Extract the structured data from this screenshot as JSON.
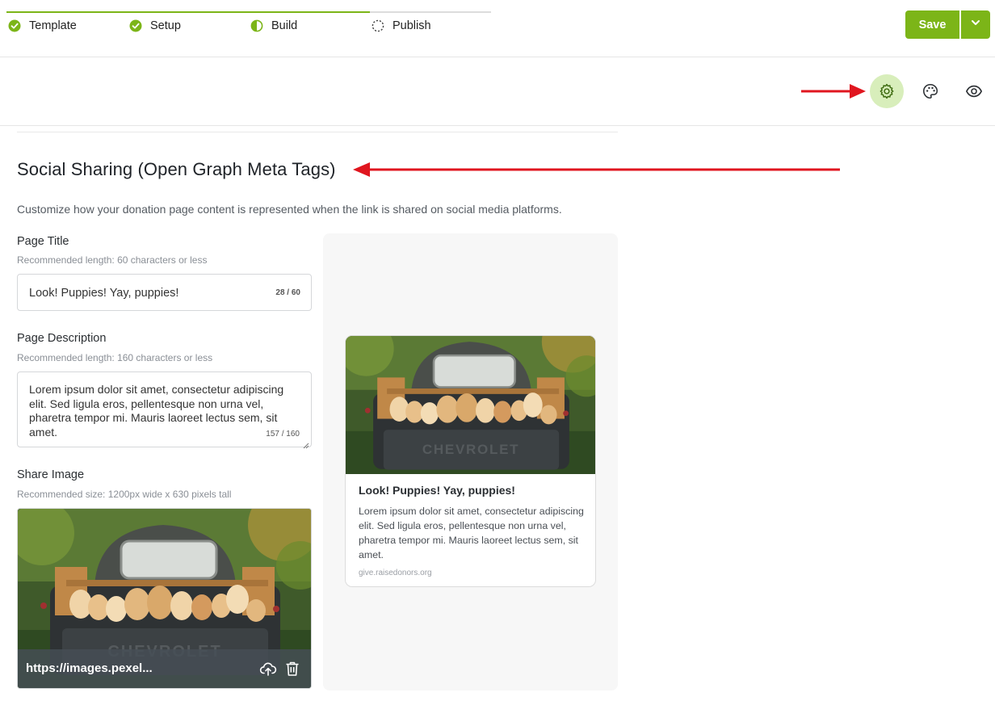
{
  "stepper": {
    "steps": [
      {
        "label": "Template",
        "status": "complete"
      },
      {
        "label": "Setup",
        "status": "complete"
      },
      {
        "label": "Build",
        "status": "in-progress"
      },
      {
        "label": "Publish",
        "status": "pending"
      }
    ]
  },
  "header": {
    "save_label": "Save",
    "save_menu_icon": "chevron-down-icon"
  },
  "toolbar": {
    "icons": [
      "gear-icon",
      "palette-icon",
      "eye-icon"
    ],
    "active": "gear-icon"
  },
  "colors": {
    "accent": "#7cb518",
    "active_tool_bg": "#d8eebb",
    "annotation": "#e0161f"
  },
  "section": {
    "title": "Social Sharing (Open Graph Meta Tags)",
    "description": "Customize how your donation page content is represented when the link is shared on social media platforms."
  },
  "form": {
    "page_title": {
      "label": "Page Title",
      "hint": "Recommended length: 60 characters or less",
      "value": "Look! Puppies! Yay, puppies!",
      "counter": "28 / 60"
    },
    "page_description": {
      "label": "Page Description",
      "hint": "Recommended length: 160 characters or less",
      "value": "Lorem ipsum dolor sit amet, consectetur adipiscing elit. Sed ligula eros, pellentesque non urna vel, pharetra tempor mi. Mauris laoreet lectus sem, sit amet.",
      "counter": "157 / 160"
    },
    "share_image": {
      "label": "Share Image",
      "hint": "Recommended size: 1200px wide x 630 pixels tall",
      "url": "https://images.pexel...",
      "actions": [
        "upload-icon",
        "trash-icon"
      ]
    }
  },
  "preview": {
    "title": "Look! Puppies! Yay, puppies!",
    "description": "Lorem ipsum dolor sit amet, consectetur adipiscing elit. Sed ligula eros, pellentesque non urna vel, pharetra tempor mi. Mauris laoreet lectus sem, sit amet.",
    "domain": "give.raisedonors.org"
  }
}
